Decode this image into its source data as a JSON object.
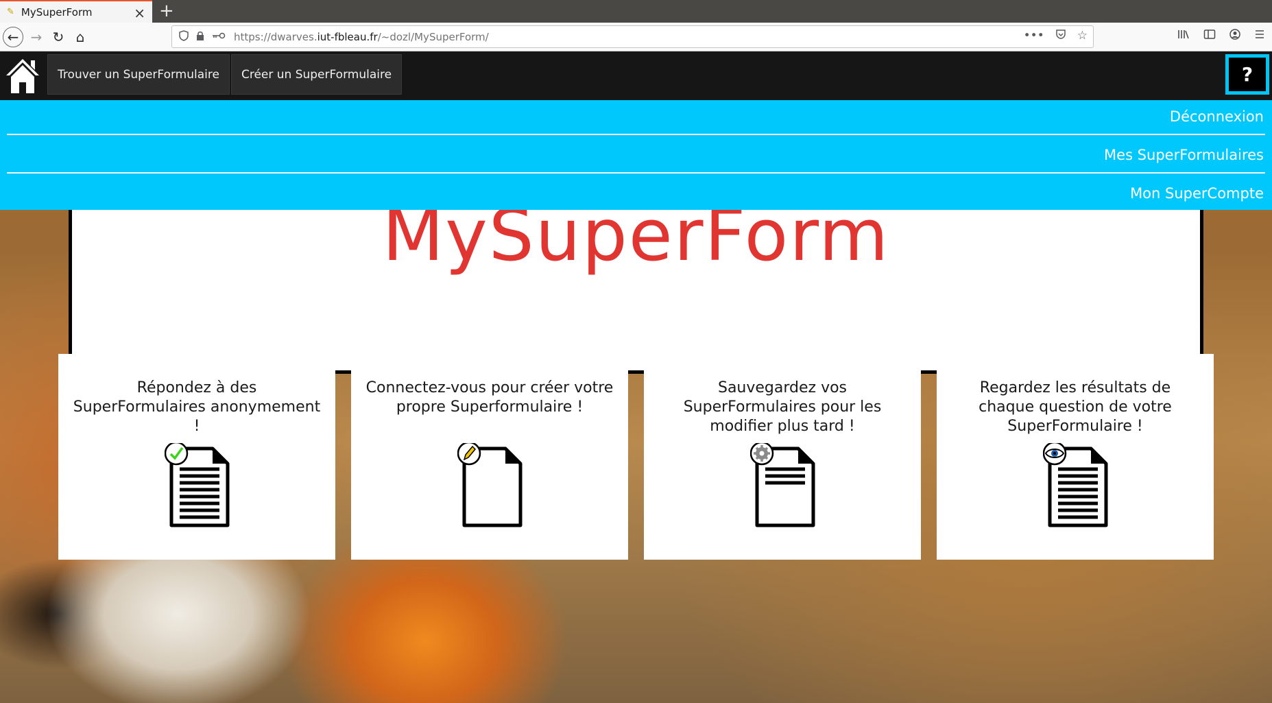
{
  "browser": {
    "tab_title": "MySuperForm",
    "tab_close": "×",
    "new_tab": "+",
    "url_scheme_path_prefix": "https://dwarves.",
    "url_host": "iut-fbleau.fr",
    "url_path": "/~dozl/MySuperForm/",
    "back": "←",
    "forward": "→",
    "reload": "↻",
    "home": "⌂"
  },
  "site": {
    "nav": [
      {
        "label": "Trouver un SuperFormulaire"
      },
      {
        "label": "Créer un SuperFormulaire"
      }
    ],
    "help_label": "?",
    "dropdown": [
      {
        "label": "Déconnexion"
      },
      {
        "label": "Mes SuperFormulaires"
      },
      {
        "label": "Mon SuperCompte"
      }
    ],
    "hero_title": "MySuperForm",
    "cards": [
      {
        "text": "Répondez à des SuperFormulaires anonymement !",
        "icon": "document-check-icon"
      },
      {
        "text": "Connectez-vous pour créer votre propre Superformulaire !",
        "icon": "document-pencil-icon"
      },
      {
        "text": "Sauvegardez vos SuperFormulaires pour les modifier plus tard !",
        "icon": "document-gear-icon"
      },
      {
        "text": "Regardez les résultats de chaque question de votre SuperFormulaire !",
        "icon": "document-eye-icon"
      }
    ]
  },
  "colors": {
    "accent": "#00c8fd",
    "title_red": "#e03530",
    "header_bg": "#161616"
  }
}
